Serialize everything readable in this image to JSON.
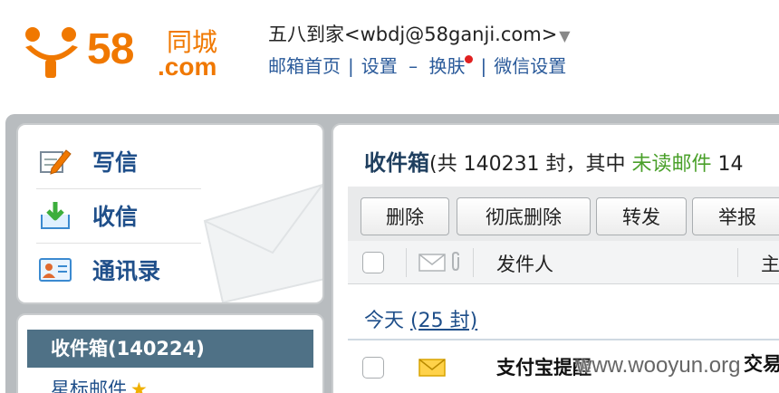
{
  "header": {
    "logo_number": "58",
    "logo_brand": "同城",
    "logo_suffix": ".com",
    "user_display": "五八到家<wbdj@58ganji.com>",
    "links": [
      "邮箱首页",
      "设置",
      "换肤",
      "微信设置"
    ],
    "link_separator": "|",
    "dash": "–",
    "brand_color": "#f07800"
  },
  "sidebar": {
    "actions": [
      {
        "label": "写信",
        "icon": "pencil-note-icon"
      },
      {
        "label": "收信",
        "icon": "inbox-download-icon"
      },
      {
        "label": "通讯录",
        "icon": "contact-card-icon"
      }
    ],
    "folders": [
      {
        "label": "收件箱(140224)",
        "active": true
      },
      {
        "label": "星标邮件",
        "icon": "star-icon"
      }
    ]
  },
  "main": {
    "title": "收件箱",
    "summary_prefix": "(共 140231 封，其中 ",
    "unread_label": "未读邮件",
    "summary_suffix": " 14",
    "toolbar_buttons": [
      "删除",
      "彻底删除",
      "转发",
      "举报"
    ],
    "columns": {
      "sender": "发件人",
      "subject": "主"
    },
    "group": {
      "label": "今天",
      "count": "(25 封)"
    },
    "rows": [
      {
        "sender": "支付宝提醒",
        "subject": "交易",
        "icon": "envelope-icon"
      }
    ]
  },
  "watermark": "www.wooyun.org",
  "colors": {
    "accent": "#1f4f8a",
    "active_folder": "#4f7186",
    "unread": "#4aa02a",
    "frame": "#b8bcbf"
  }
}
